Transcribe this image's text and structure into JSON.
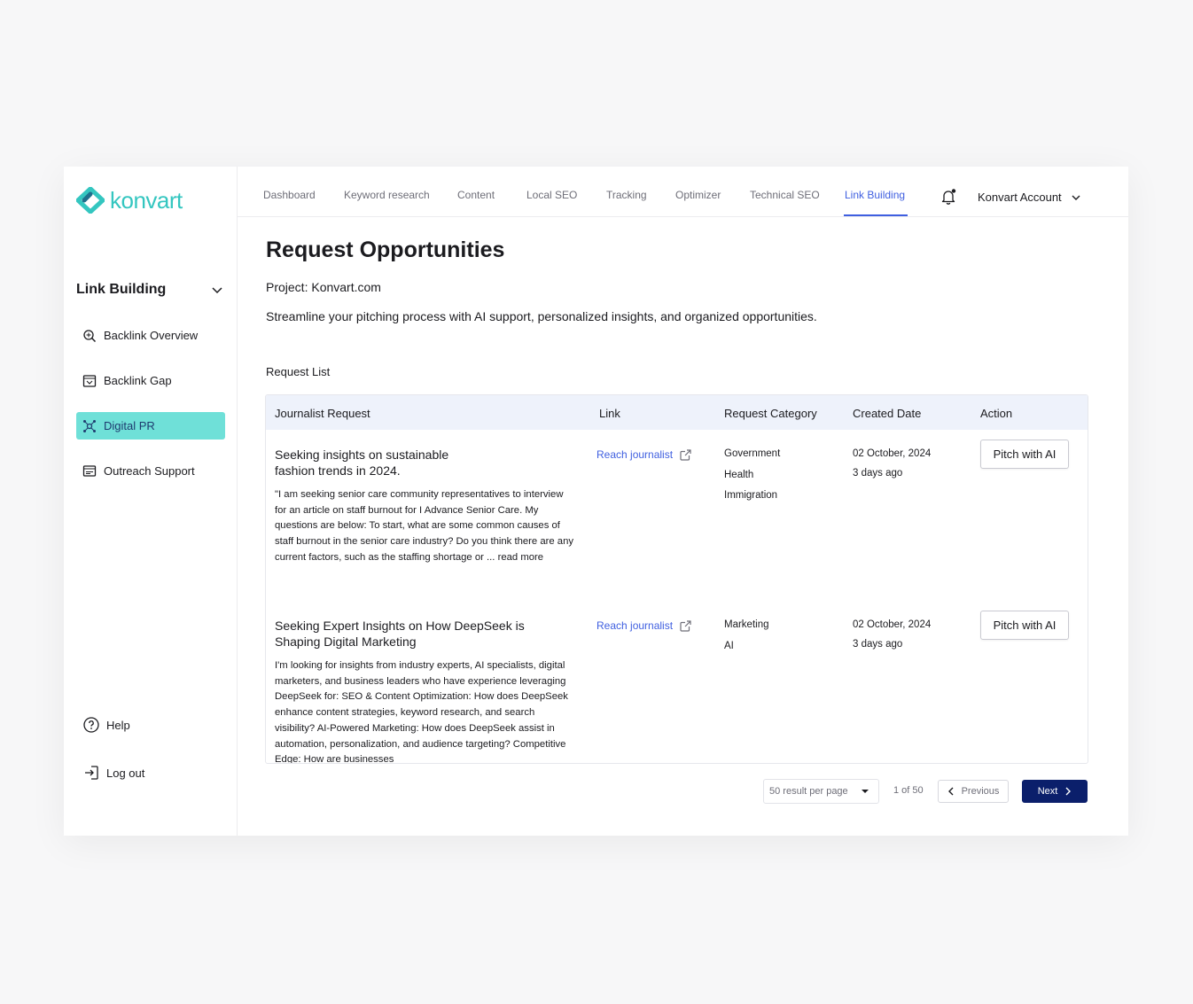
{
  "brand": {
    "name": "konvart",
    "color": "#34c6c0"
  },
  "nav": {
    "tabs": [
      {
        "label": "Dashboard"
      },
      {
        "label": "Keyword research"
      },
      {
        "label": "Content"
      },
      {
        "label": "Local SEO"
      },
      {
        "label": "Tracking"
      },
      {
        "label": "Optimizer"
      },
      {
        "label": "Technical SEO"
      },
      {
        "label": "Link Building",
        "active": true
      }
    ],
    "account": "Konvart Account",
    "active_color": "#3f5fe0"
  },
  "sidebar": {
    "group_title": "Link Building",
    "items": [
      {
        "label": "Backlink Overview",
        "icon": "backlink-overview-icon"
      },
      {
        "label": "Backlink Gap",
        "icon": "backlink-gap-icon"
      },
      {
        "label": "Digital PR",
        "icon": "digital-pr-icon",
        "active": true
      },
      {
        "label": "Outreach Support",
        "icon": "outreach-support-icon"
      }
    ],
    "help": "Help",
    "logout": "Log out"
  },
  "main": {
    "title": "Request Opportunities",
    "project": "Project: Konvart.com",
    "subtitle": "Streamline your pitching process with AI support, personalized insights, and organized opportunities.",
    "list_title": "Request List"
  },
  "table": {
    "headers": [
      "Journalist Request",
      "Link",
      "Request Category",
      "Created Date",
      "Action"
    ],
    "rows": [
      {
        "title": "Seeking insights on sustainable fashion trends in 2024.",
        "body": "\"I am seeking senior care community representatives to interview for an article on staff burnout for I Advance Senior Care. My questions are below: To start, what are some common causes of staff burnout in the senior care industry? Do you think there are any current factors, such as the staffing shortage or ... read more",
        "link": "Reach journalist",
        "categories": [
          "Government",
          "Health",
          "Immigration"
        ],
        "date": "02 October, 2024",
        "ago": "3 days ago",
        "action": "Pitch with AI"
      },
      {
        "title": "Seeking Expert Insights on How DeepSeek is Shaping Digital Marketing",
        "body": "I'm looking for insights from industry experts, AI specialists, digital marketers, and business leaders who have experience leveraging DeepSeek for: SEO & Content Optimization: How does DeepSeek enhance content strategies, keyword research, and search visibility? AI-Powered Marketing: How does DeepSeek assist in automation, personalization, and audience targeting? Competitive Edge: How are businesses",
        "link": "Reach journalist",
        "categories": [
          "Marketing",
          "AI"
        ],
        "date": "02 October, 2024",
        "ago": "3 days ago",
        "action": "Pitch with AI"
      }
    ]
  },
  "pagination": {
    "per_page": "50 result per page",
    "info": "1 of 50",
    "previous": "Previous",
    "next": "Next"
  }
}
